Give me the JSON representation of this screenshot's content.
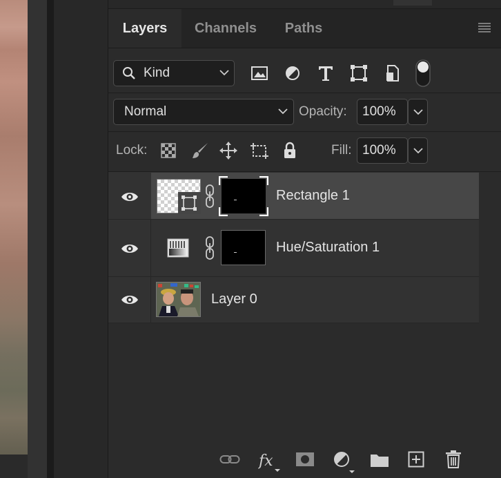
{
  "tabs": [
    "Layers",
    "Channels",
    "Paths"
  ],
  "filter": {
    "kind_label": "Kind"
  },
  "filter_icons": [
    "image-filter-icon",
    "adjustment-filter-icon",
    "type-filter-icon",
    "shape-filter-icon",
    "smart-object-filter-icon",
    "filter-toggle-icon"
  ],
  "blend_mode": "Normal",
  "opacity": {
    "label": "Opacity:",
    "value": "100%"
  },
  "lock": {
    "label": "Lock:",
    "icons": [
      "lock-transparent-pixels-icon",
      "lock-image-pixels-icon",
      "lock-position-icon",
      "lock-artboard-icon",
      "lock-all-icon"
    ]
  },
  "fill": {
    "label": "Fill:",
    "value": "100%"
  },
  "layers": [
    {
      "name": "Rectangle 1",
      "selected": true,
      "visible": true,
      "type": "shape"
    },
    {
      "name": "Hue/Saturation 1",
      "selected": false,
      "visible": true,
      "type": "adjustment"
    },
    {
      "name": "Layer 0",
      "selected": false,
      "visible": true,
      "type": "image"
    }
  ],
  "footer_icons": [
    "link-layers-icon",
    "fx-icon",
    "add-mask-icon",
    "new-adjustment-icon",
    "new-group-icon",
    "new-layer-icon",
    "delete-layer-icon"
  ],
  "colors": {
    "panel": "#2b2b2b",
    "selected_row": "#474747",
    "field": "#1e1e1e"
  }
}
